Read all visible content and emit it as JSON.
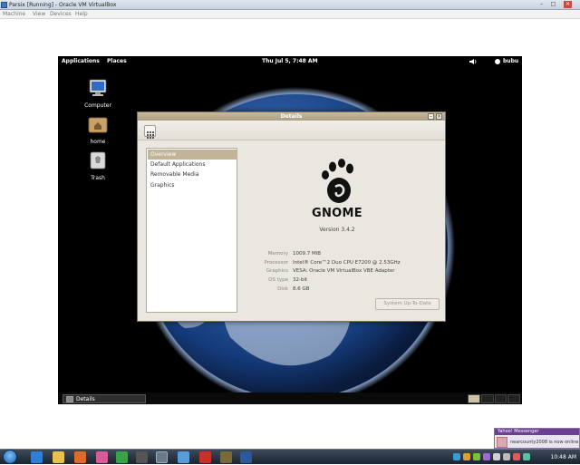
{
  "vbox": {
    "title": "Parsix [Running] - Oracle VM VirtualBox",
    "menu": [
      "Machine",
      "View",
      "Devices",
      "Help"
    ],
    "minimize": "–",
    "maximize": "□",
    "close": "✕"
  },
  "guest": {
    "top_panel": {
      "applications": "Applications",
      "places": "Places",
      "clock": "Thu Jul  5,  7:48 AM",
      "user": "bubu"
    },
    "desktop_icons": [
      {
        "label": "Computer"
      },
      {
        "label": "home"
      },
      {
        "label": "Trash"
      }
    ],
    "bottom_panel": {
      "task_label": "Details"
    },
    "details": {
      "title": "Details",
      "sidebar": [
        {
          "label": "Overview",
          "selected": true
        },
        {
          "label": "Default Applications"
        },
        {
          "label": "Removable Media"
        },
        {
          "label": "Graphics"
        }
      ],
      "logo_text": "GNOME",
      "version": "Version 3.4.2",
      "info": [
        {
          "key": "Memory",
          "value": "1009.7 MiB"
        },
        {
          "key": "Processor",
          "value": "Intel® Core™2 Duo CPU E7200 @ 2.53GHz"
        },
        {
          "key": "Graphics",
          "value": "VESA: Oracle VM VirtualBox VBE Adapter"
        },
        {
          "key": "OS type",
          "value": "32-bit"
        },
        {
          "key": "Disk",
          "value": "8.6 GB"
        }
      ],
      "update_button": "System Up-To-Date"
    }
  },
  "host": {
    "clock": "10:48 AM",
    "yahoo": {
      "title": "Yahoo! Messenger",
      "message": "nearcounty2008 is now online"
    }
  },
  "colors": {
    "gnome_title": "#ad9f85",
    "sidebar_selected": "#c2b597",
    "yahoo_purple": "#6d3f93"
  }
}
